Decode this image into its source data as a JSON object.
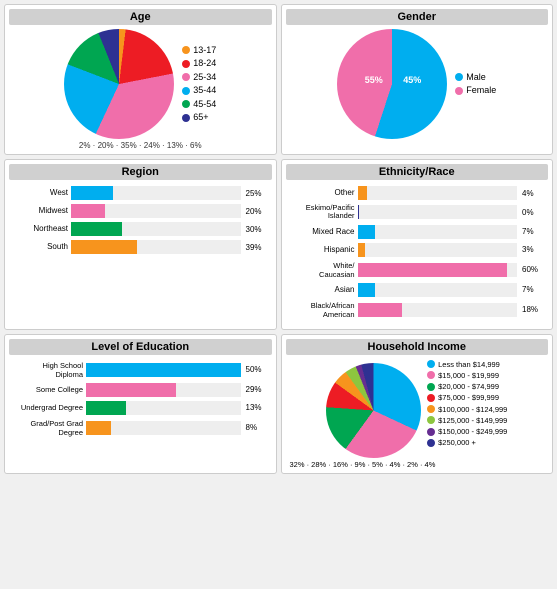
{
  "panels": {
    "age": {
      "title": "Age",
      "segments": [
        {
          "label": "13-17",
          "pct": 2,
          "color": "#f7941d",
          "deg": 7
        },
        {
          "label": "18-24",
          "pct": 20,
          "color": "#ed1c24",
          "deg": 72
        },
        {
          "label": "25-34",
          "pct": 35,
          "color": "#f06eaa",
          "deg": 126
        },
        {
          "label": "35-44",
          "pct": 24,
          "color": "#00aeef",
          "deg": 86
        },
        {
          "label": "45-54",
          "pct": 13,
          "color": "#00a651",
          "deg": 47
        },
        {
          "label": "65+",
          "pct": 6,
          "color": "#2e3192",
          "deg": 22
        }
      ]
    },
    "gender": {
      "title": "Gender",
      "segments": [
        {
          "label": "Male",
          "pct": 55,
          "color": "#00aeef",
          "deg": 198
        },
        {
          "label": "Female",
          "pct": 45,
          "color": "#f06eaa",
          "deg": 162
        }
      ]
    },
    "region": {
      "title": "Region",
      "bars": [
        {
          "label": "West",
          "pct": 25,
          "color": "#00aeef"
        },
        {
          "label": "Midwest",
          "pct": 20,
          "color": "#f06eaa"
        },
        {
          "label": "Northeast",
          "pct": 30,
          "color": "#00a651"
        },
        {
          "label": "South",
          "pct": 39,
          "color": "#f7941d"
        }
      ]
    },
    "ethnicity": {
      "title": "Ethnicity/Race",
      "bars": [
        {
          "label": "Other",
          "pct": 4,
          "color": "#f7941d"
        },
        {
          "label": "Eskimo/Pacific Islander",
          "pct": 0,
          "color": "#2e3192"
        },
        {
          "label": "Mixed Race",
          "pct": 7,
          "color": "#00aeef"
        },
        {
          "label": "Hispanic",
          "pct": 3,
          "color": "#f7941d"
        },
        {
          "label": "White/Caucasian",
          "pct": 60,
          "color": "#f06eaa"
        },
        {
          "label": "Asian",
          "pct": 7,
          "color": "#00aeef"
        },
        {
          "label": "Black/African American",
          "pct": 18,
          "color": "#f06eaa"
        }
      ]
    },
    "education": {
      "title": "Level of Education",
      "bars": [
        {
          "label": "High School Diploma",
          "pct": 50,
          "color": "#00aeef"
        },
        {
          "label": "Some College",
          "pct": 29,
          "color": "#f06eaa"
        },
        {
          "label": "Undergrad Degree",
          "pct": 13,
          "color": "#00a651"
        },
        {
          "label": "Grad/Post Grad Degree",
          "pct": 8,
          "color": "#f7941d"
        }
      ]
    },
    "income": {
      "title": "Household Income",
      "segments": [
        {
          "label": "Less than $14,999",
          "pct": 32,
          "color": "#00aeef",
          "deg": 115
        },
        {
          "label": "$15,000 - $19,999",
          "pct": 28,
          "color": "#f06eaa",
          "deg": 101
        },
        {
          "label": "$20,000 - $74,999",
          "pct": 16,
          "color": "#00a651",
          "deg": 58
        },
        {
          "label": "$75,000 - $99,999",
          "pct": 9,
          "color": "#ed1c24",
          "deg": 32
        },
        {
          "label": "$100,000 - $124,999",
          "pct": 5,
          "color": "#f7941d",
          "deg": 18
        },
        {
          "label": "$125,000 - $149,999",
          "pct": 4,
          "color": "#8dc63f",
          "deg": 14
        },
        {
          "label": "$150,000 - $249,999",
          "pct": 2,
          "color": "#662d91",
          "deg": 7
        },
        {
          "label": "$250,000 +",
          "pct": 4,
          "color": "#2e3192",
          "deg": 14
        }
      ]
    }
  }
}
